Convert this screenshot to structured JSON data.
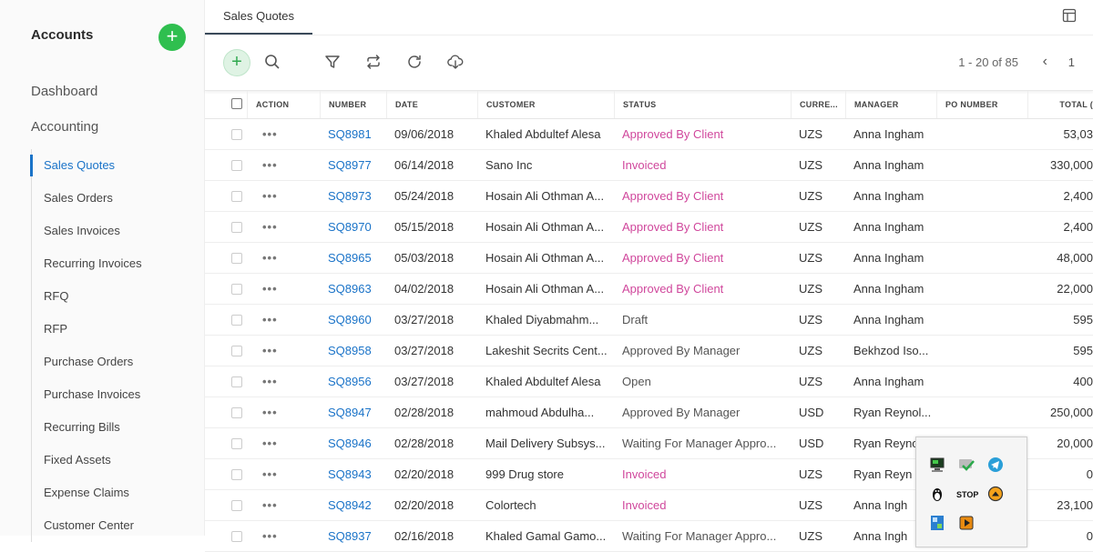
{
  "sidebar": {
    "title": "Accounts",
    "add_label": "+",
    "main_items": [
      "Dashboard",
      "Accounting"
    ],
    "sub_items": [
      "Sales Quotes",
      "Sales Orders",
      "Sales Invoices",
      "Recurring Invoices",
      "RFQ",
      "RFP",
      "Purchase Orders",
      "Purchase Invoices",
      "Recurring Bills",
      "Fixed Assets",
      "Expense Claims",
      "Customer Center"
    ],
    "active_index": 0
  },
  "tabs": [
    {
      "label": "Sales Quotes"
    }
  ],
  "toolbar": {
    "add_label": "+",
    "icons": [
      "search-icon",
      "filter-icon",
      "repeat-icon",
      "refresh-icon",
      "download-icon"
    ],
    "pager_text": "1 - 20 of 85",
    "prev_label": "‹",
    "page_number": "1"
  },
  "table": {
    "columns": [
      "ACTION",
      "NUMBER",
      "DATE",
      "CUSTOMER",
      "STATUS",
      "CURRE...",
      "MANAGER",
      "PO NUMBER",
      "TOTAL ("
    ],
    "rows": [
      {
        "action": "•••",
        "number": "SQ8981",
        "date": "09/06/2018",
        "customer": "Khaled Abdultef Alesa",
        "status": "Approved By Client",
        "currency": "UZS",
        "manager": "Anna Ingham",
        "po": "",
        "total": "53,03"
      },
      {
        "action": "•••",
        "number": "SQ8977",
        "date": "06/14/2018",
        "customer": "Sano Inc",
        "status": "Invoiced",
        "currency": "UZS",
        "manager": "Anna Ingham",
        "po": "",
        "total": "330,000"
      },
      {
        "action": "•••",
        "number": "SQ8973",
        "date": "05/24/2018",
        "customer": "Hosain Ali Othman A...",
        "status": "Approved By Client",
        "currency": "UZS",
        "manager": "Anna Ingham",
        "po": "",
        "total": "2,400"
      },
      {
        "action": "•••",
        "number": "SQ8970",
        "date": "05/15/2018",
        "customer": "Hosain Ali Othman A...",
        "status": "Approved By Client",
        "currency": "UZS",
        "manager": "Anna Ingham",
        "po": "",
        "total": "2,400"
      },
      {
        "action": "•••",
        "number": "SQ8965",
        "date": "05/03/2018",
        "customer": "Hosain Ali Othman A...",
        "status": "Approved By Client",
        "currency": "UZS",
        "manager": "Anna Ingham",
        "po": "",
        "total": "48,000"
      },
      {
        "action": "•••",
        "number": "SQ8963",
        "date": "04/02/2018",
        "customer": "Hosain Ali Othman A...",
        "status": "Approved By Client",
        "currency": "UZS",
        "manager": "Anna Ingham",
        "po": "",
        "total": "22,000"
      },
      {
        "action": "•••",
        "number": "SQ8960",
        "date": "03/27/2018",
        "customer": "Khaled Diyabmahm...",
        "status": "Draft",
        "currency": "UZS",
        "manager": "Anna Ingham",
        "po": "",
        "total": "595"
      },
      {
        "action": "•••",
        "number": "SQ8958",
        "date": "03/27/2018",
        "customer": "Lakeshit Secrits Cent...",
        "status": "Approved By Manager",
        "currency": "UZS",
        "manager": "Bekhzod Iso...",
        "po": "",
        "total": "595"
      },
      {
        "action": "•••",
        "number": "SQ8956",
        "date": "03/27/2018",
        "customer": "Khaled Abdultef Alesa",
        "status": "Open",
        "currency": "UZS",
        "manager": "Anna Ingham",
        "po": "",
        "total": "400"
      },
      {
        "action": "•••",
        "number": "SQ8947",
        "date": "02/28/2018",
        "customer": "mahmoud Abdulha...",
        "status": "Approved By Manager",
        "currency": "USD",
        "manager": "Ryan Reynol...",
        "po": "",
        "total": "250,000"
      },
      {
        "action": "•••",
        "number": "SQ8946",
        "date": "02/28/2018",
        "customer": "Mail Delivery Subsys...",
        "status": "Waiting For Manager Appro...",
        "currency": "USD",
        "manager": "Ryan Reynol...",
        "po": "",
        "total": "20,000"
      },
      {
        "action": "•••",
        "number": "SQ8943",
        "date": "02/20/2018",
        "customer": "999 Drug store",
        "status": "Invoiced",
        "currency": "UZS",
        "manager": "Ryan Reyn",
        "po": "",
        "total": "0"
      },
      {
        "action": "•••",
        "number": "SQ8942",
        "date": "02/20/2018",
        "customer": "Colortech",
        "status": "Invoiced",
        "currency": "UZS",
        "manager": "Anna Ingh",
        "po": "",
        "total": "23,100"
      },
      {
        "action": "•••",
        "number": "SQ8937",
        "date": "02/16/2018",
        "customer": "Khaled Gamal Gamo...",
        "status": "Waiting For Manager Appro...",
        "currency": "UZS",
        "manager": "Anna Ingh",
        "po": "",
        "total": "0"
      }
    ]
  },
  "tray": {
    "icons": [
      "monitor-icon",
      "check-icon",
      "telegram-icon",
      "tux-icon",
      "stop-icon",
      "arrow-up-icon",
      "network-icon",
      "play-icon"
    ],
    "stop_label": "STOP"
  },
  "colors": {
    "accent": "#1a73c8",
    "add_green": "#2fbf4f",
    "status_pink": "#d0479c"
  }
}
